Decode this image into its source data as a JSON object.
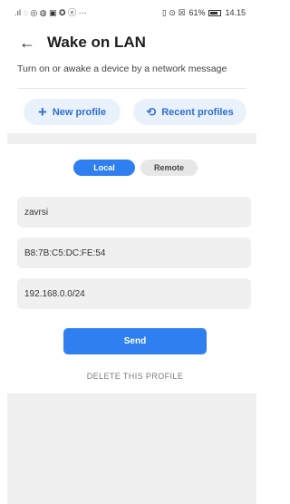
{
  "status_bar": {
    "left_icons": [
      "signal-icon",
      "wifi-icon",
      "sync-icon",
      "media-icon",
      "image-icon",
      "chat-icon",
      "mail-icon",
      "more-icon"
    ],
    "left_glyphs": ".ıl ◌ ◎ ◍ ▣ ✪ ⓔ ···",
    "right_glyphs": "▯ ⊙ ☒",
    "battery_text": "61%",
    "time": "14.15"
  },
  "app_bar": {
    "back_icon": "←",
    "title": "Wake on LAN"
  },
  "subtitle": "Turn on or awake a device by a network message",
  "actions": {
    "new_profile": {
      "icon": "+",
      "label": "New profile"
    },
    "recent_profiles": {
      "icon": "⟲",
      "label": "Recent profiles"
    }
  },
  "mode_toggle": {
    "options": [
      "Local",
      "Remote"
    ],
    "selected": "Local"
  },
  "fields": {
    "name": "zavrsi",
    "mac": "B8:7B:C5:DC:FE:54",
    "address": "192.168.0.0/24"
  },
  "send_label": "Send",
  "delete_label": "DELETE THIS PROFILE",
  "colors": {
    "accent": "#2f7ff0",
    "pill_bg": "#e9f1fb",
    "pill_text": "#2f6fd1",
    "field_bg": "#f0f0f0"
  }
}
